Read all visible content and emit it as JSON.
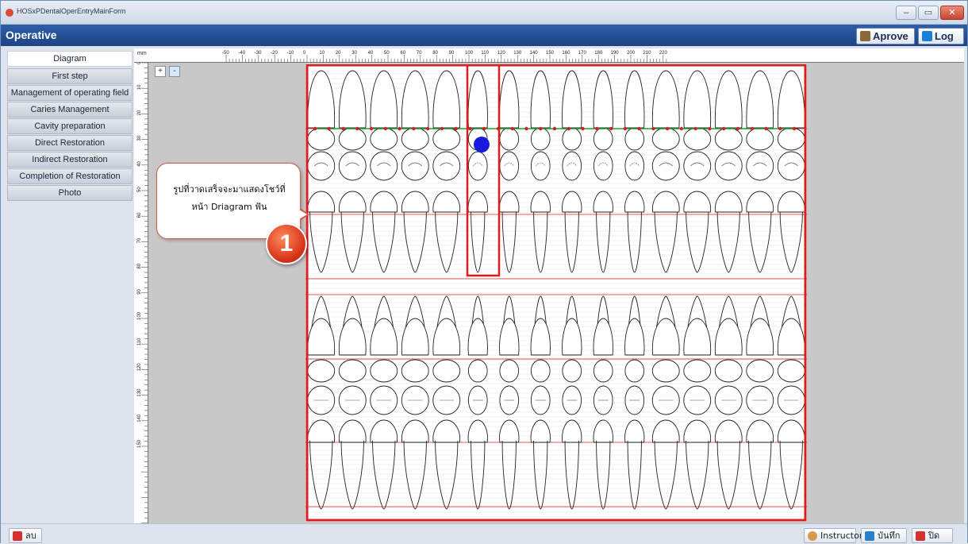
{
  "window": {
    "title": "HOSxPDentalOperEntryMainForm"
  },
  "window_controls": {
    "minimize": "–",
    "maximize": "▭",
    "close": "✕"
  },
  "header": {
    "app_title": "Operative",
    "approve_label": "Aprove",
    "log_label": "Log"
  },
  "sidebar": {
    "items": [
      {
        "label": "Diagram",
        "active": true
      },
      {
        "label": "First step"
      },
      {
        "label": "Management of operating field"
      },
      {
        "label": "Caries Management"
      },
      {
        "label": "Cavity preparation"
      },
      {
        "label": "Direct Restoration"
      },
      {
        "label": "Indirect Restoration"
      },
      {
        "label": "Completion of Restoration"
      },
      {
        "label": "Photo"
      }
    ]
  },
  "ruler": {
    "unit": "mm",
    "top_ticks": [
      "-50",
      "-40",
      "-30",
      "-20",
      "-10",
      "0",
      "10",
      "20",
      "30",
      "40",
      "50",
      "60",
      "70",
      "80",
      "90",
      "100",
      "110",
      "120",
      "130",
      "140",
      "150",
      "160",
      "170",
      "180",
      "190",
      "200",
      "210",
      "220"
    ],
    "left_ticks": [
      "0",
      "10",
      "20",
      "30",
      "40",
      "50",
      "60",
      "70",
      "80",
      "90",
      "100",
      "110",
      "120",
      "130",
      "140",
      "150"
    ]
  },
  "zoom": {
    "in": "+",
    "out": "-"
  },
  "annotation": {
    "callout_line1": "รูปที่วาดเสร็จจะมาแสดงโชว์ที่",
    "callout_line2": "หน้า Driagram ฟัน",
    "badge_number": "1"
  },
  "footer": {
    "delete_label": "ลบ",
    "instructor_label": "Instructor",
    "save_label": "บันทึก",
    "close_label": "ปิด"
  },
  "colors": {
    "header_bg": "#1d4384",
    "highlight": "#d62020",
    "marker": "#1a1adf",
    "guide_green": "#1aa030"
  }
}
